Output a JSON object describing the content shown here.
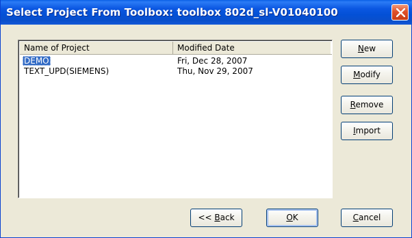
{
  "window": {
    "title": "Select Project  From Toolbox: toolbox 802d_sl-V01040100"
  },
  "list": {
    "columns": [
      "Name of Project",
      "Modified Date"
    ],
    "rows": [
      {
        "name": "DEMO",
        "date": "Fri, Dec 28, 2007",
        "selected": true
      },
      {
        "name": "TEXT_UPD(SIEMENS)",
        "date": "Thu, Nov 29, 2007",
        "selected": false
      }
    ]
  },
  "buttons": {
    "new": {
      "mn": "N",
      "rest": "ew"
    },
    "modify": {
      "mn": "M",
      "rest": "odify"
    },
    "remove": {
      "mn": "R",
      "rest": "emove"
    },
    "import": {
      "mn": "I",
      "rest": "mport"
    },
    "back": {
      "pre": "<< ",
      "mn": "B",
      "rest": "ack"
    },
    "ok": {
      "mn": "O",
      "rest": "K"
    },
    "cancel": {
      "mn": "C",
      "rest": "ancel"
    }
  },
  "colors": {
    "titlebar": "#0a5fe6",
    "selection": "#316ac5",
    "dialog_bg": "#ece9d8"
  },
  "icons": {
    "close": "close-icon"
  }
}
